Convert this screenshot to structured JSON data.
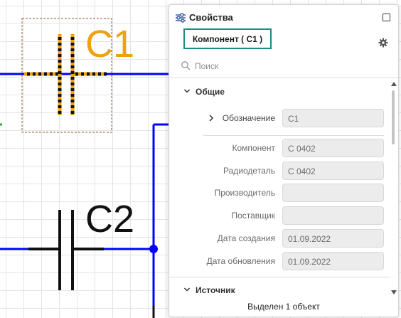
{
  "schematic": {
    "c1_designator": "C1",
    "c2_designator": "C2",
    "wire_color": "#0000ff",
    "selection_color": "#f0a010"
  },
  "panel": {
    "title": "Свойства",
    "component_tab_label": "Компонент ( С1 )",
    "search_placeholder": "Поиск",
    "status_text": "Выделен 1 объект",
    "sections": {
      "general": {
        "title": "Общие",
        "rows": [
          {
            "label": "Обозначение",
            "value": "С1"
          },
          {
            "label": "Компонент",
            "value": "С 0402"
          },
          {
            "label": "Радиодеталь",
            "value": "С 0402"
          },
          {
            "label": "Производитель",
            "value": ""
          },
          {
            "label": "Поставщик",
            "value": ""
          },
          {
            "label": "Дата создания",
            "value": "01.09.2022"
          },
          {
            "label": "Дата обновления",
            "value": "01.09.2022"
          }
        ]
      },
      "source": {
        "title": "Источник"
      }
    },
    "accent_color": "#1e8a84"
  }
}
